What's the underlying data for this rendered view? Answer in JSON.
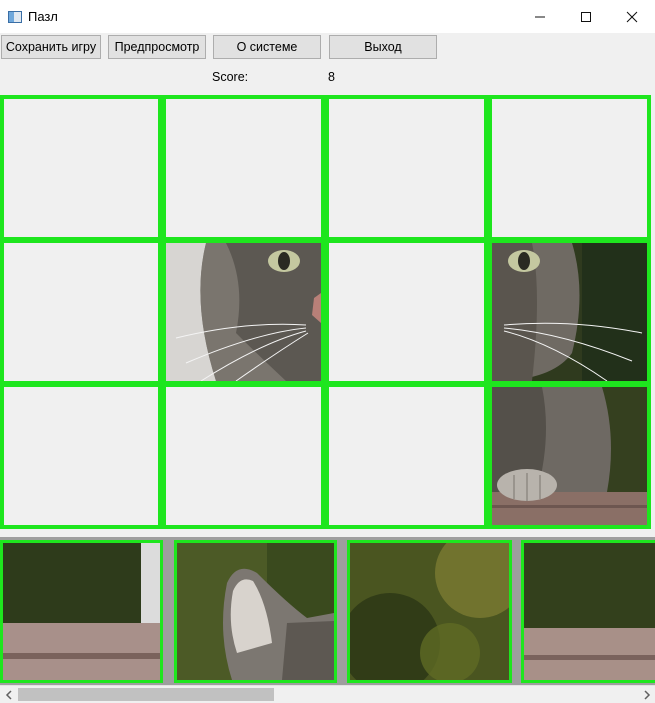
{
  "window": {
    "title": "Пазл",
    "app_icon": "app-window-icon",
    "controls": [
      "minimize-icon",
      "maximize-icon",
      "close-icon"
    ]
  },
  "toolbar": {
    "save_label": "Сохранить игру",
    "preview_label": "Предпросмотр",
    "about_label": "О системе",
    "exit_label": "Выход"
  },
  "score": {
    "label": "Score:",
    "value": "8"
  },
  "board": {
    "rows": 3,
    "cols": 4,
    "cells": [
      {
        "row": 0,
        "col": 0,
        "tile": null
      },
      {
        "row": 0,
        "col": 1,
        "tile": null
      },
      {
        "row": 0,
        "col": 2,
        "tile": null
      },
      {
        "row": 0,
        "col": 3,
        "tile": null
      },
      {
        "row": 1,
        "col": 0,
        "tile": null
      },
      {
        "row": 1,
        "col": 1,
        "tile": "cat-face-right-half"
      },
      {
        "row": 1,
        "col": 2,
        "tile": null
      },
      {
        "row": 1,
        "col": 3,
        "tile": "cat-face-left-half"
      },
      {
        "row": 2,
        "col": 0,
        "tile": null
      },
      {
        "row": 2,
        "col": 1,
        "tile": null
      },
      {
        "row": 2,
        "col": 2,
        "tile": null
      },
      {
        "row": 2,
        "col": 3,
        "tile": "cat-paws"
      }
    ],
    "accent_color": "#1ee61e"
  },
  "tray": {
    "tiles": [
      "wooden-plank-corner",
      "cat-ear",
      "blurred-foliage",
      "wooden-plank-edge"
    ]
  },
  "scrollbar": {
    "left_arrow": "chevron-left-icon",
    "right_arrow": "chevron-right-icon"
  }
}
